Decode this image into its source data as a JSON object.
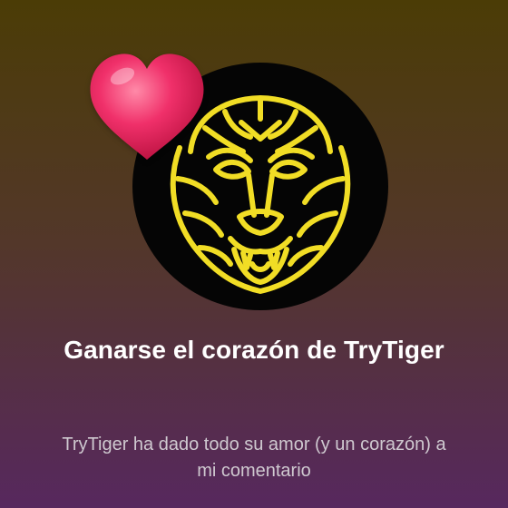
{
  "achievement": {
    "title": "Ganarse el corazón de TryTiger",
    "description": "TryTiger ha dado todo su amor (y un corazón) a mi comentario",
    "icons": {
      "avatar": "tiger-face-icon",
      "badge": "heart-icon"
    },
    "colors": {
      "tiger_stroke": "#f1dd25",
      "avatar_bg": "#050505",
      "heart": "#f0306a",
      "title": "#ffffff",
      "description": "#cfc9d0"
    }
  }
}
